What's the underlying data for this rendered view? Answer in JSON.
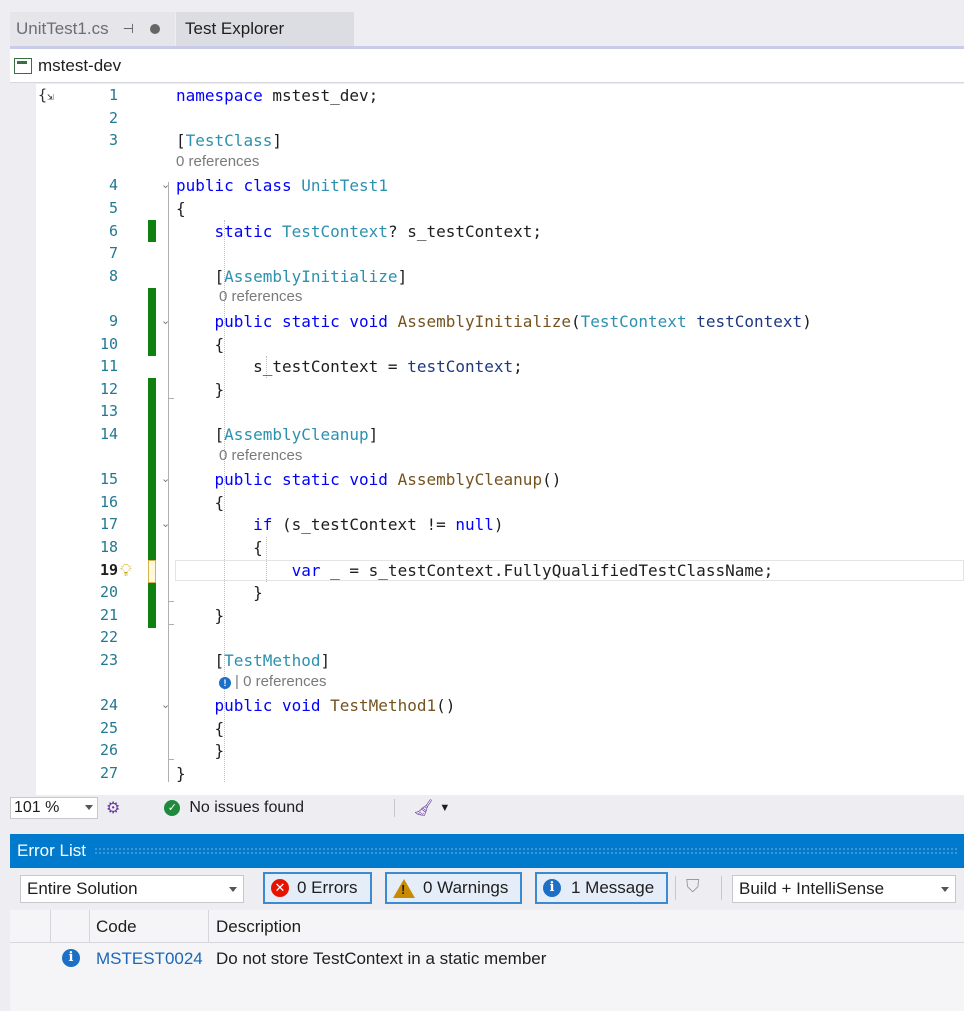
{
  "tabs": [
    {
      "label": "UnitTest1.cs",
      "active": false
    },
    {
      "label": "Test Explorer",
      "active": true
    }
  ],
  "navbar": {
    "project": "mstest-dev"
  },
  "editor": {
    "lines": [
      {
        "n": "1",
        "parts": [
          [
            "kw",
            "namespace"
          ],
          [
            "",
            " mstest_dev;"
          ]
        ]
      },
      {
        "n": "2",
        "parts": []
      },
      {
        "n": "3",
        "parts": [
          [
            "",
            "["
          ],
          [
            "ty",
            "TestClass"
          ],
          [
            "",
            "]"
          ]
        ]
      },
      {
        "n": "4",
        "parts": [
          [
            "kw",
            "public"
          ],
          [
            "",
            " "
          ],
          [
            "kw",
            "class"
          ],
          [
            "",
            " "
          ],
          [
            "ty",
            "UnitTest1"
          ]
        ]
      },
      {
        "n": "5",
        "parts": [
          [
            "",
            "{"
          ]
        ]
      },
      {
        "n": "6",
        "parts": [
          [
            "",
            "    "
          ],
          [
            "kw",
            "static"
          ],
          [
            "",
            " "
          ],
          [
            "ty",
            "TestContext"
          ],
          [
            "",
            "? s_testContext;"
          ]
        ]
      },
      {
        "n": "7",
        "parts": []
      },
      {
        "n": "8",
        "parts": [
          [
            "",
            "    ["
          ],
          [
            "ty",
            "AssemblyInitialize"
          ],
          [
            "",
            "]"
          ]
        ]
      },
      {
        "n": "9",
        "parts": [
          [
            "",
            "    "
          ],
          [
            "kw",
            "public"
          ],
          [
            "",
            " "
          ],
          [
            "kw",
            "static"
          ],
          [
            "",
            " "
          ],
          [
            "kw",
            "void"
          ],
          [
            "",
            " "
          ],
          [
            "me",
            "AssemblyInitialize"
          ],
          [
            "",
            "("
          ],
          [
            "ty",
            "TestContext"
          ],
          [
            "",
            " "
          ],
          [
            "pa",
            "testContext"
          ],
          [
            "",
            ")"
          ]
        ]
      },
      {
        "n": "10",
        "parts": [
          [
            "",
            "    {"
          ]
        ]
      },
      {
        "n": "11",
        "parts": [
          [
            "",
            "        s_testContext = "
          ],
          [
            "pa",
            "testContext"
          ],
          [
            "",
            ";"
          ]
        ]
      },
      {
        "n": "12",
        "parts": [
          [
            "",
            "    }"
          ]
        ]
      },
      {
        "n": "13",
        "parts": []
      },
      {
        "n": "14",
        "parts": [
          [
            "",
            "    ["
          ],
          [
            "ty",
            "AssemblyCleanup"
          ],
          [
            "",
            "]"
          ]
        ]
      },
      {
        "n": "15",
        "parts": [
          [
            "",
            "    "
          ],
          [
            "kw",
            "public"
          ],
          [
            "",
            " "
          ],
          [
            "kw",
            "static"
          ],
          [
            "",
            " "
          ],
          [
            "kw",
            "void"
          ],
          [
            "",
            " "
          ],
          [
            "me",
            "AssemblyCleanup"
          ],
          [
            "",
            "()"
          ]
        ]
      },
      {
        "n": "16",
        "parts": [
          [
            "",
            "    {"
          ]
        ]
      },
      {
        "n": "17",
        "parts": [
          [
            "",
            "        "
          ],
          [
            "kw",
            "if"
          ],
          [
            "",
            " (s_testContext != "
          ],
          [
            "kw",
            "null"
          ],
          [
            "",
            ")"
          ]
        ]
      },
      {
        "n": "18",
        "parts": [
          [
            "",
            "        {"
          ]
        ]
      },
      {
        "n": "19",
        "parts": [
          [
            "",
            "            "
          ],
          [
            "kw",
            "var"
          ],
          [
            "",
            " _ = s_testContext.FullyQualifiedTestClassName;"
          ]
        ]
      },
      {
        "n": "20",
        "parts": [
          [
            "",
            "        }"
          ]
        ]
      },
      {
        "n": "21",
        "parts": [
          [
            "",
            "    }"
          ]
        ]
      },
      {
        "n": "22",
        "parts": []
      },
      {
        "n": "23",
        "parts": [
          [
            "",
            "    ["
          ],
          [
            "ty",
            "TestMethod"
          ],
          [
            "",
            "]"
          ]
        ]
      },
      {
        "n": "24",
        "parts": [
          [
            "",
            "    "
          ],
          [
            "kw",
            "public"
          ],
          [
            "",
            " "
          ],
          [
            "kw",
            "void"
          ],
          [
            "",
            " "
          ],
          [
            "me",
            "TestMethod1"
          ],
          [
            "",
            "()"
          ]
        ]
      },
      {
        "n": "25",
        "parts": [
          [
            "",
            "    {"
          ]
        ]
      },
      {
        "n": "26",
        "parts": [
          [
            "",
            "    }"
          ]
        ]
      },
      {
        "n": "27",
        "parts": [
          [
            "",
            "}"
          ]
        ]
      }
    ],
    "codelens": {
      "after3": "0 references",
      "after8": "0 references",
      "after14": "0 references",
      "after23": "| 0 references"
    },
    "current_line": "19"
  },
  "editor_status": {
    "zoom": "101 %",
    "issues": "No issues found"
  },
  "error_list": {
    "title": "Error List",
    "scope": "Entire Solution",
    "errors": "0 Errors",
    "warnings": "0 Warnings",
    "messages": "1 Message",
    "source": "Build + IntelliSense",
    "columns": {
      "code": "Code",
      "description": "Description"
    },
    "rows": [
      {
        "code": "MSTEST0024",
        "description": "Do not store TestContext in a static member"
      }
    ]
  },
  "colors": {
    "accent": "#007acc",
    "keyword": "#0000ff",
    "type": "#2b91af",
    "method": "#74531f",
    "change_bar": "#108010"
  }
}
